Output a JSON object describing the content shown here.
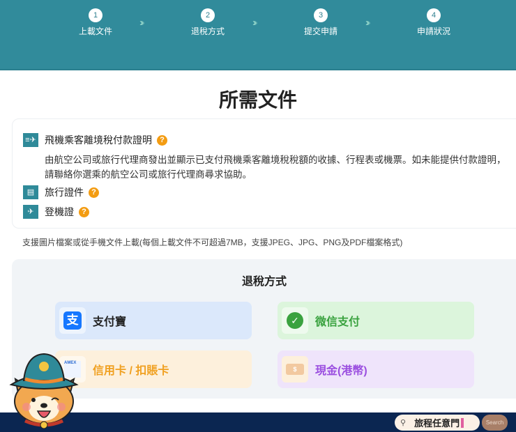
{
  "steps": [
    {
      "num": "1",
      "label": "上載文件"
    },
    {
      "num": "2",
      "label": "退稅方式"
    },
    {
      "num": "3",
      "label": "提交申請"
    },
    {
      "num": "4",
      "label": "申請狀況"
    }
  ],
  "page_title": "所需文件",
  "documents": [
    {
      "label": "飛機乘客離境稅付款證明",
      "icon": "ticket-plane-icon",
      "help": "?",
      "description": "由航空公司或旅行代理商發出並顯示已支付飛機乘客離境稅稅額的收據、行程表或機票。如未能提供付款證明，請聯絡你選乘的航空公司或旅行代理商尋求協助。"
    },
    {
      "label": "旅行證件",
      "icon": "id-card-icon",
      "help": "?"
    },
    {
      "label": "登機證",
      "icon": "boarding-pass-icon",
      "help": "?"
    }
  ],
  "upload_note": "支援圖片檔案或從手機文件上載(每個上載文件不可超過7MB，支援JPEG、JPG、PNG及PDF檔案格式)",
  "refund": {
    "title": "退稅方式",
    "methods": [
      {
        "label": "支付寶",
        "color": "#222222"
      },
      {
        "label": "微信支付",
        "color": "#3aa23f"
      },
      {
        "label": "信用卡 / 扣賬卡",
        "color": "#f0a020"
      },
      {
        "label": "現金(港幣)",
        "color": "#9b4fe0"
      }
    ]
  },
  "footer": {
    "search_value": "旅程任意門",
    "search_button": "Search"
  }
}
